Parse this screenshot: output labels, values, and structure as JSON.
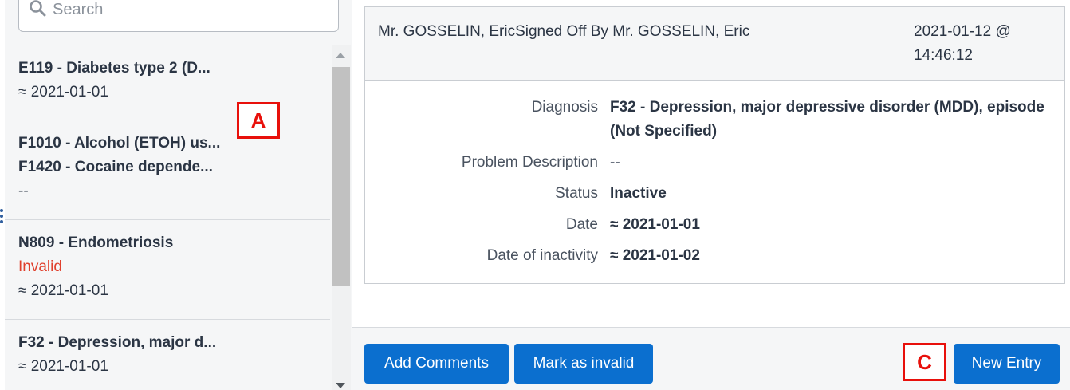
{
  "search": {
    "placeholder": "Search"
  },
  "problem_list": {
    "items": [
      {
        "lines": [
          "E119 - Diabetes type 2 (D..."
        ],
        "date": "≈ 2021-01-01"
      },
      {
        "lines": [
          "F1010 - Alcohol (ETOH) us...",
          "F1420 - Cocaine depende..."
        ],
        "date": "--"
      },
      {
        "lines": [
          "N809 - Endometriosis"
        ],
        "status": "Invalid",
        "date": "≈ 2021-01-01"
      },
      {
        "lines": [
          "F32 - Depression, major d..."
        ],
        "date": "≈ 2021-01-01"
      }
    ]
  },
  "callouts": {
    "a": "A",
    "c": "C"
  },
  "detail": {
    "signed_by": "Mr. GOSSELIN, EricSigned Off By Mr. GOSSELIN, Eric",
    "timestamp_date": "2021-01-12 @",
    "timestamp_time": "14:46:12",
    "fields": [
      {
        "label": "Diagnosis",
        "value_line1": "F32 - Depression, major depressive disorder (MDD), episode",
        "value_line2": "(Not Specified)"
      },
      {
        "label": "Problem Description",
        "value": "--"
      },
      {
        "label": "Status",
        "value": "Inactive"
      },
      {
        "label": "Date",
        "value": "≈ 2021-01-01"
      },
      {
        "label": "Date of inactivity",
        "value": "≈ 2021-01-02"
      }
    ]
  },
  "actions": {
    "add_comments": "Add Comments",
    "mark_invalid": "Mark as invalid",
    "new_entry": "New Entry"
  },
  "colors": {
    "primary": "#0b6fcf",
    "invalid": "#e0402d",
    "callout": "#e8100b"
  }
}
